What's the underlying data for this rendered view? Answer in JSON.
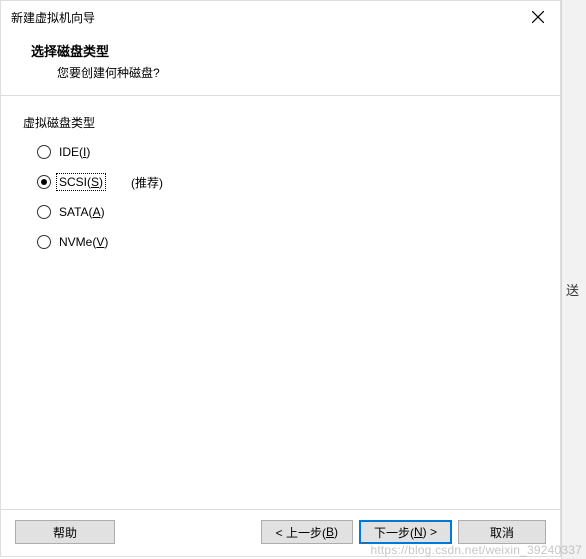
{
  "window": {
    "title": "新建虚拟机向导"
  },
  "header": {
    "title": "选择磁盘类型",
    "subtitle": "您要创建何种磁盘?"
  },
  "group": {
    "label": "虚拟磁盘类型",
    "options": [
      {
        "label_pre": "IDE(",
        "mnemonic": "I",
        "label_post": ")",
        "selected": false,
        "suffix": ""
      },
      {
        "label_pre": "SCSI(",
        "mnemonic": "S",
        "label_post": ")",
        "selected": true,
        "suffix": "(推荐)"
      },
      {
        "label_pre": "SATA(",
        "mnemonic": "A",
        "label_post": ")",
        "selected": false,
        "suffix": ""
      },
      {
        "label_pre": "NVMe(",
        "mnemonic": "V",
        "label_post": ")",
        "selected": false,
        "suffix": ""
      }
    ]
  },
  "buttons": {
    "help": "帮助",
    "back_pre": "< 上一步(",
    "back_mn": "B",
    "back_post": ")",
    "next_pre": "下一步(",
    "next_mn": "N",
    "next_post": ") >",
    "cancel": "取消"
  },
  "side_glyph": "送",
  "watermark": "https://blog.csdn.net/weixin_39240337"
}
